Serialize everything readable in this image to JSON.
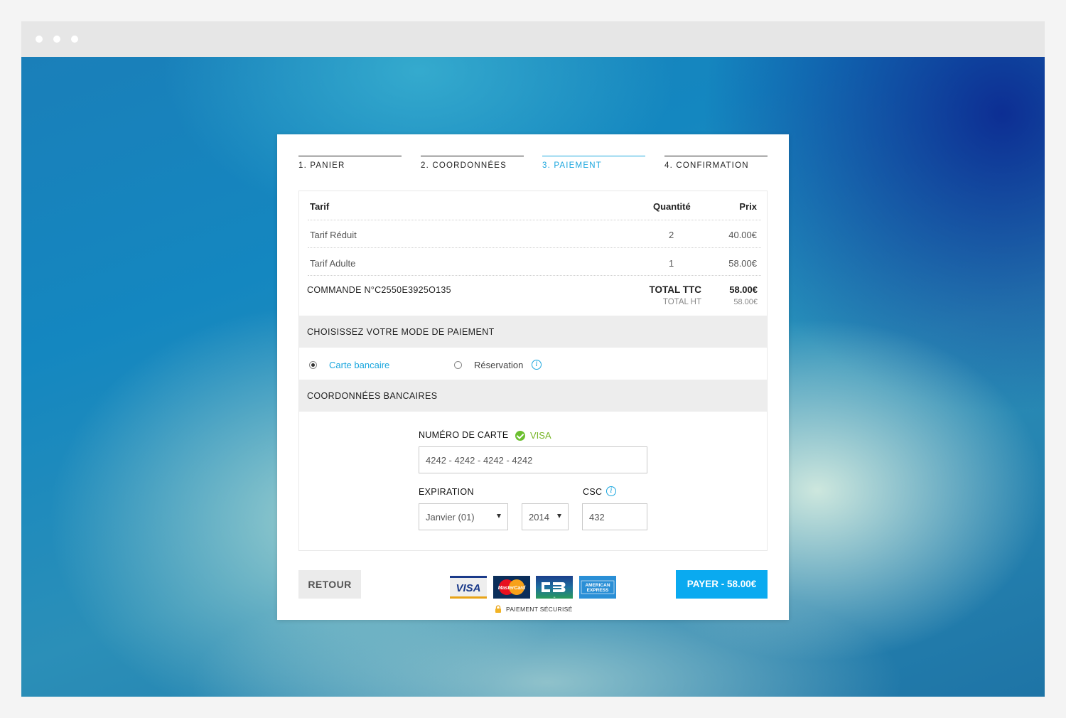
{
  "steps": [
    {
      "label": "1. PANIER"
    },
    {
      "label": "2. COORDONNÉES"
    },
    {
      "label": "3. PAIEMENT"
    },
    {
      "label": "4. CONFIRMATION"
    }
  ],
  "cart": {
    "headers": {
      "tarif": "Tarif",
      "quantite": "Quantité",
      "prix": "Prix"
    },
    "rows": [
      {
        "tarif": "Tarif Réduit",
        "quantite": "2",
        "prix": "40.00€"
      },
      {
        "tarif": "Tarif Adulte",
        "quantite": "1",
        "prix": "58.00€"
      }
    ],
    "order_label": "COMMANDE N°C2550E3925O135",
    "total_ttc_label": "TOTAL TTC",
    "total_ttc_value": "58.00€",
    "total_ht_label": "TOTAL HT",
    "total_ht_value": "58.00€"
  },
  "payment_mode": {
    "heading": "CHOISISSEZ VOTRE MODE DE PAIEMENT",
    "options": [
      {
        "label": "Carte bancaire",
        "selected": true
      },
      {
        "label": "Réservation",
        "selected": false
      }
    ],
    "info_glyph": "i"
  },
  "bank": {
    "heading": "COORDONNÉES BANCAIRES",
    "card_number_label": "NUMÉRO DE CARTE",
    "detected_brand": "VISA",
    "card_number_value": "4242 - 4242 - 4242 - 4242",
    "expiration_label": "EXPIRATION",
    "month_value": "Janvier (01)",
    "year_value": "2014",
    "csc_label": "CSC",
    "csc_value": "432",
    "info_glyph": "i"
  },
  "footer": {
    "back_label": "RETOUR",
    "pay_label": "PAYER - 58.00€",
    "secure_label": "PAIEMENT SÉCURISÉ",
    "card_logos": [
      {
        "name": "visa-logo",
        "text": "VISA"
      },
      {
        "name": "mastercard-logo",
        "text": "MasterCard"
      },
      {
        "name": "cb-logo",
        "text": "CB"
      },
      {
        "name": "amex-logo",
        "text": "AMERICAN EXPRESS"
      }
    ]
  },
  "colors": {
    "accent": "#1aa6de",
    "pay_button": "#0aaaf0",
    "valid": "#6bbf2f"
  }
}
